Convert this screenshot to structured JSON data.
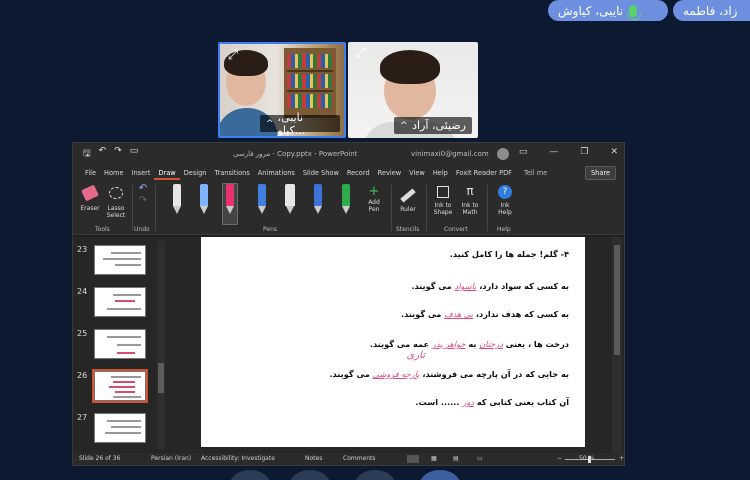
{
  "participants_top": [
    {
      "name": "نایبی، کیاوش",
      "mic": "mic-on-icon"
    },
    {
      "name": "زاد، فاطمه"
    }
  ],
  "video_tiles": [
    {
      "name": "نایبی، کیاو...",
      "chevron": "^"
    },
    {
      "name": "رضیئی، آراد",
      "chevron": "^"
    }
  ],
  "ppt": {
    "doc_title": "مرور فارسی - Copy.pptx - PowerPoint",
    "account": "vinimaxi0@gmail.com",
    "tabs": [
      "File",
      "Home",
      "Insert",
      "Draw",
      "Design",
      "Transitions",
      "Animations",
      "Slide Show",
      "Record",
      "Review",
      "View",
      "Help",
      "Foxit Reader PDF"
    ],
    "active_tab": "Draw",
    "tell_me": "Tell me",
    "share": "Share",
    "ribbon": {
      "eraser": "Eraser",
      "lasso": "Lasso Select",
      "tools_group": "Tools",
      "undo_group": "Undo",
      "pens_group": "Pens",
      "add_pen": "Add Pen",
      "ruler": "Ruler",
      "stencils_group": "Stencils",
      "ink_to_shape": "Ink to Shape",
      "ink_to_math": "Ink to Math",
      "convert_group": "Convert",
      "ink_help": "Ink Help",
      "help_group": "Help"
    },
    "pen_colors": [
      "#e6e6e6",
      "#7fb2ff",
      "#e8336f",
      "#3f7fe0",
      "#e6e6e6",
      "#3d73d9",
      "#2eab4a"
    ],
    "thumbnails": [
      "23",
      "24",
      "25",
      "26",
      "27"
    ],
    "selected_thumb": "26",
    "slide": {
      "heading": "۴- گلم! جمله ها را کامل کنید.",
      "lines": [
        {
          "text": "به کسی که سواد دارد،",
          "ink": "باسواد",
          "tail": "می گویند."
        },
        {
          "text": "به کسی که هدف ندارد،",
          "ink": "بی هدف",
          "tail": "می گویند."
        },
        {
          "text": "درخت ها ، یعنی",
          "ink": "درختان",
          "mid": "به",
          "ink2": "خواهر پدر",
          "tail": "عمه می گویند."
        },
        {
          "text": "به جایی که در آن پارچه می فروشند،",
          "ink": "پارچه فروشی",
          "tail": "می گویند."
        },
        {
          "text": "آن کتاب یعنی کتابی که",
          "ink": "دور",
          "tail": "...... است."
        }
      ],
      "extra_ink": "تاری"
    },
    "status": {
      "slide_count": "Slide 26 of 36",
      "language": "Persian (Iran)",
      "accessibility": "Accessibility: Investigate",
      "notes": "Notes",
      "comments": "Comments",
      "zoom": "50 %"
    }
  }
}
